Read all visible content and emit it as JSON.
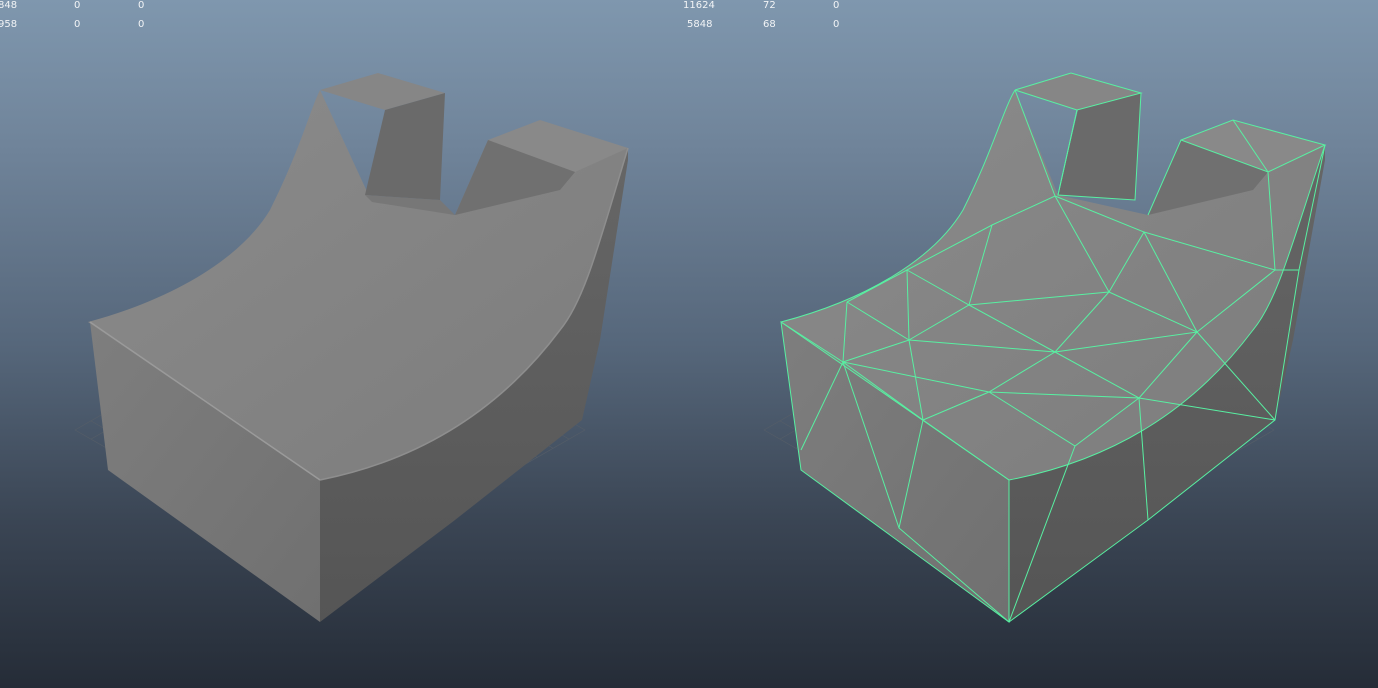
{
  "viewports": [
    {
      "name": "smooth-shaded",
      "hud": {
        "rows": [
          [
            "848",
            "0",
            "0"
          ],
          [
            "958",
            "0",
            "0"
          ]
        ]
      }
    },
    {
      "name": "wireframe-on-shaded",
      "hud": {
        "rows": [
          [
            "11624",
            "72",
            "0"
          ],
          [
            "5848",
            "68",
            "0"
          ]
        ]
      }
    }
  ],
  "colors": {
    "wireframe": "#58f0a2",
    "model_top": "#8a8a8a",
    "model_front": "#7a7a7a",
    "model_side": "#606060",
    "grid": "#5a6068"
  }
}
